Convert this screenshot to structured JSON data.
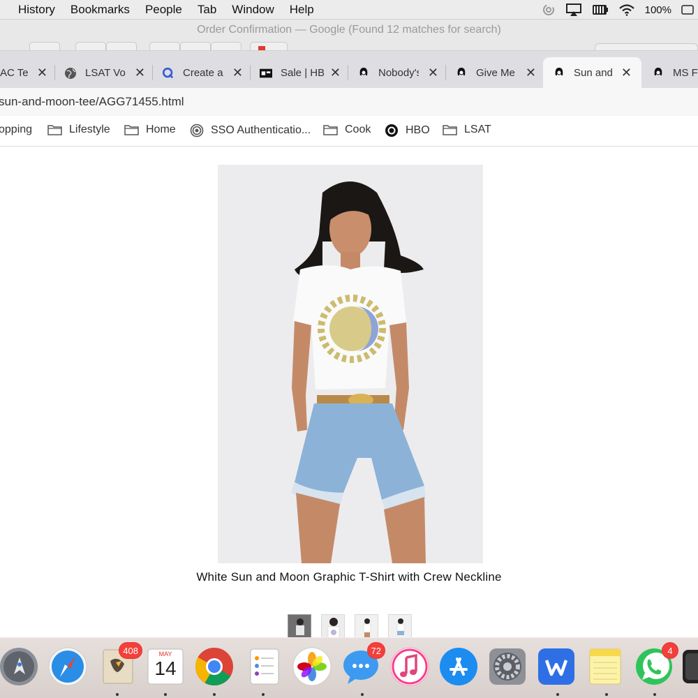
{
  "menubar": {
    "items": [
      "History",
      "Bookmarks",
      "People",
      "Tab",
      "Window",
      "Help"
    ],
    "battery_percent": "100%"
  },
  "window": {
    "title": "Order Confirmation — Google (Found 12 matches for search)"
  },
  "tabs": [
    {
      "label": "AC Te",
      "icon": "partial-icon"
    },
    {
      "label": "LSAT Vo",
      "icon": "globe-icon"
    },
    {
      "label": "Create a",
      "icon": "q-icon"
    },
    {
      "label": "Sale | HB",
      "icon": "hb-icon"
    },
    {
      "label": "Nobody's",
      "icon": "woman-icon"
    },
    {
      "label": "Give Me",
      "icon": "woman-icon"
    },
    {
      "label": "Sun and",
      "icon": "woman-icon",
      "active": true
    },
    {
      "label": "MS Fi",
      "icon": "woman-icon"
    }
  ],
  "address": {
    "url": "sun-and-moon-tee/AGG71455.html"
  },
  "bookmarks": [
    {
      "label": "opping",
      "icon": "none"
    },
    {
      "label": "Lifestyle",
      "icon": "folder-icon"
    },
    {
      "label": "Home",
      "icon": "folder-icon"
    },
    {
      "label": "SSO Authenticatio...",
      "icon": "sso-icon"
    },
    {
      "label": "Cook",
      "icon": "folder-icon"
    },
    {
      "label": "HBO",
      "icon": "hbo-icon"
    },
    {
      "label": "LSAT",
      "icon": "folder-icon"
    }
  ],
  "product": {
    "caption": "White Sun and Moon Graphic T-Shirt with Crew Neckline",
    "thumbnail_count": 4
  },
  "dock": {
    "mail_badge": "408",
    "calendar_month": "MAY",
    "calendar_day": "14",
    "messages_badge": "72",
    "whatsapp_badge": "4"
  },
  "colors": {
    "badge": "#f2403a",
    "chrome_blue": "#4285f4"
  }
}
